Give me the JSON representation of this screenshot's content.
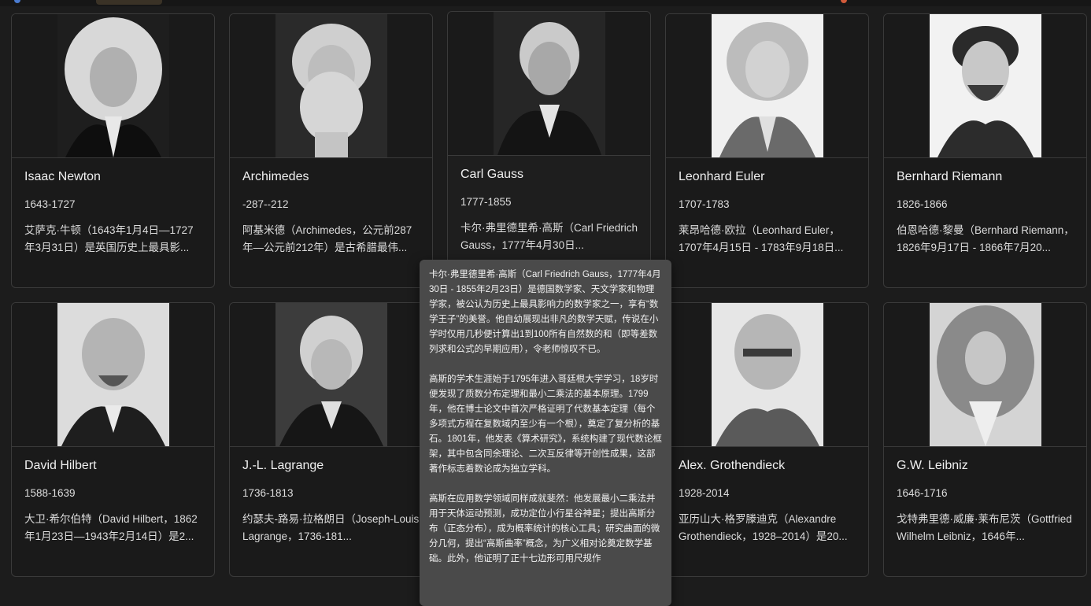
{
  "cards": [
    {
      "name": "Isaac Newton",
      "years": "1643-1727",
      "bio": "艾萨克·牛顿（1643年1月4日—1727年3月31日）是英国历史上最具影..."
    },
    {
      "name": "Archimedes",
      "years": "-287--212",
      "bio": "阿基米德（Archimedes，公元前287年—公元前212年）是古希腊最伟..."
    },
    {
      "name": "Carl Gauss",
      "years": "1777-1855",
      "bio": "卡尔·弗里德里希·高斯（Carl Friedrich Gauss，1777年4月30日..."
    },
    {
      "name": "Leonhard Euler",
      "years": "1707-1783",
      "bio": "莱昂哈德·欧拉（Leonhard Euler，1707年4月15日 - 1783年9月18日..."
    },
    {
      "name": "Bernhard Riemann",
      "years": "1826-1866",
      "bio": "伯恩哈德·黎曼（Bernhard Riemann，1826年9月17日 - 1866年7月20..."
    },
    {
      "name": "David Hilbert",
      "years": "1588-1639",
      "bio": "大卫·希尔伯特（David Hilbert，1862年1月23日—1943年2月14日）是2..."
    },
    {
      "name": "J.-L. Lagrange",
      "years": "1736-1813",
      "bio": "约瑟夫-路易·拉格朗日（Joseph-Louis Lagrange，1736-181..."
    },
    {
      "name": "Alex. Grothendieck",
      "years": "1928-2014",
      "bio": "亚历山大·格罗滕迪克（Alexandre Grothendieck，1928–2014）是20..."
    },
    {
      "name": "G.W. Leibniz",
      "years": "1646-1716",
      "bio": "戈特弗里德·威廉·莱布尼茨（Gottfried Wilhelm Leibniz，1646年..."
    }
  ],
  "tooltip": {
    "paragraphs": [
      "卡尔·弗里德里希·高斯（Carl Friedrich Gauss，1777年4月30日 - 1855年2月23日）是德国数学家、天文学家和物理学家，被公认为历史上最具影响力的数学家之一，享有“数学王子”的美誉。他自幼展现出非凡的数学天赋，传说在小学时仅用几秒便计算出1到100所有自然数的和（即等差数列求和公式的早期应用），令老师惊叹不已。",
      "高斯的学术生涯始于1795年进入哥廷根大学学习，18岁时便发现了质数分布定理和最小二乘法的基本原理。1799年，他在博士论文中首次严格证明了代数基本定理（每个多项式方程在复数域内至少有一个根），奠定了复分析的基石。1801年，他发表《算术研究》，系统构建了现代数论框架，其中包含同余理论、二次互反律等开创性成果，这部著作标志着数论成为独立学科。",
      "高斯在应用数学领域同样成就斐然：他发展最小二乘法并用于天体运动预测，成功定位小行星谷神星；提出高斯分布（正态分布），成为概率统计的核心工具；研究曲面的微分几何，提出“高斯曲率”概念，为广义相对论奠定数学基础。此外，他证明了正十七边形可用尺规作"
    ]
  },
  "colors": {
    "page_bg": "#1c1c1c",
    "card_bg": "#1a1a1a",
    "card_border": "#3a3a3a",
    "tooltip_bg": "#4a4a4a"
  }
}
